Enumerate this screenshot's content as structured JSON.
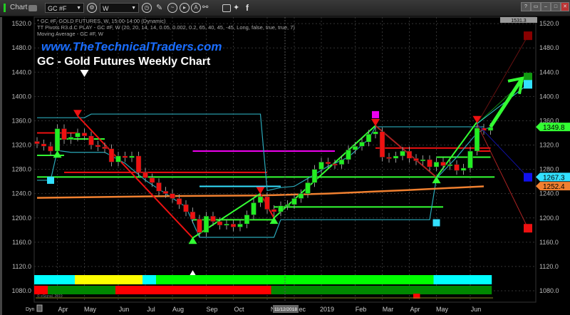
{
  "toolbar": {
    "window_label": "Chart",
    "symbol": "GC #F",
    "interval": "W",
    "icons": [
      "link-icon",
      "clock-icon",
      "pencil-icon",
      "chart-style-icon",
      "play-icon",
      "alert-icon",
      "link-chain-icon",
      "comment-icon",
      "twitter-icon",
      "facebook-icon"
    ],
    "window_buttons": [
      "?",
      "▭",
      "–",
      "□",
      "✕"
    ]
  },
  "legend": [
    "* GC #F, GOLD FUTURES, W, 15:00-14:00 (Dynamic)",
    "TT Pivots R3.d.C PLAY - GC #F, W (20, 20, 14, 14, 0.05, 0.002, 0.2, 65, 40, 45, -45, Long, false, true, true, 7)",
    "Moving Average - GC #F, W"
  ],
  "brand": "www.TheTechnicalTraders.com",
  "title": "GC - Gold Futures Weekly Chart",
  "footer": {
    "dyn_label": "Dyn",
    "cursor_date": "11/12/2018",
    "copyright": "© eSignal, 2019"
  },
  "chart_data": {
    "type": "candlestick",
    "ylim": [
      1060,
      1531.3
    ],
    "yticks": [
      1080,
      1120,
      1160,
      1200,
      1240,
      1280,
      1320,
      1360,
      1400,
      1440,
      1480,
      1520
    ],
    "xtick_labels": [
      [
        "2018-04-02",
        "Apr"
      ],
      [
        "2018-04-30",
        "May"
      ],
      [
        "2018-06-04",
        "Jun"
      ],
      [
        "2018-07-02",
        "Jul"
      ],
      [
        "2018-07-30",
        "Aug"
      ],
      [
        "2018-09-03",
        "Sep"
      ],
      [
        "2018-10-01",
        "Oct"
      ],
      [
        "2018-11-05",
        "N"
      ],
      [
        "2018-12-03",
        "Dec"
      ],
      [
        "2018-12-31",
        "2019"
      ],
      [
        "2019-02-04",
        "Feb"
      ],
      [
        "2019-03-04",
        "Mar"
      ],
      [
        "2019-04-01",
        "Apr"
      ],
      [
        "2019-04-29",
        "May"
      ],
      [
        "2019-06-03",
        "Jun"
      ]
    ],
    "grid": true,
    "dates": [
      "2018-03-12",
      "2018-03-19",
      "2018-03-26",
      "2018-04-02",
      "2018-04-09",
      "2018-04-16",
      "2018-04-23",
      "2018-04-30",
      "2018-05-07",
      "2018-05-14",
      "2018-05-21",
      "2018-05-28",
      "2018-06-04",
      "2018-06-11",
      "2018-06-18",
      "2018-06-25",
      "2018-07-02",
      "2018-07-09",
      "2018-07-16",
      "2018-07-23",
      "2018-07-30",
      "2018-08-06",
      "2018-08-13",
      "2018-08-20",
      "2018-08-27",
      "2018-09-03",
      "2018-09-10",
      "2018-09-17",
      "2018-09-24",
      "2018-10-01",
      "2018-10-08",
      "2018-10-15",
      "2018-10-22",
      "2018-10-29",
      "2018-11-05",
      "2018-11-12",
      "2018-11-19",
      "2018-11-26",
      "2018-12-03",
      "2018-12-10",
      "2018-12-17",
      "2018-12-24",
      "2018-12-31",
      "2019-01-07",
      "2019-01-14",
      "2019-01-21",
      "2019-01-28",
      "2019-02-04",
      "2019-02-11",
      "2019-02-18",
      "2019-02-25",
      "2019-03-04",
      "2019-03-11",
      "2019-03-18",
      "2019-03-25",
      "2019-04-01",
      "2019-04-08",
      "2019-04-15",
      "2019-04-22",
      "2019-04-29",
      "2019-05-06",
      "2019-05-13",
      "2019-05-20",
      "2019-05-27",
      "2019-06-03",
      "2019-06-10",
      "2019-06-17",
      "2019-06-24"
    ],
    "close": [
      1322,
      1318,
      1310,
      1347,
      1329,
      1333,
      1340,
      1335,
      1320,
      1317,
      1314,
      1292,
      1302,
      1299,
      1302,
      1275,
      1266,
      1258,
      1244,
      1240,
      1232,
      1222,
      1210,
      1198,
      1176,
      1203,
      1194,
      1188,
      1190,
      1185,
      1190,
      1205,
      1225,
      1235,
      1214,
      1210,
      1220,
      1222,
      1232,
      1240,
      1258,
      1280,
      1292,
      1289,
      1288,
      1296,
      1312,
      1318,
      1325,
      1338,
      1342,
      1300,
      1298,
      1302,
      1310,
      1298,
      1294,
      1296,
      1284,
      1292,
      1286,
      1288,
      1278,
      1282,
      1310,
      1348,
      1344,
      1349
    ],
    "colors": {
      "up": "#22ee22",
      "down": "#ee1111",
      "background": "#000000"
    },
    "moving_average": {
      "color": "#f08030",
      "points": [
        [
          "2018-03-12",
          1233
        ],
        [
          "2018-04-30",
          1234
        ],
        [
          "2018-07-30",
          1236
        ],
        [
          "2018-10-29",
          1237
        ],
        [
          "2019-01-07",
          1240
        ],
        [
          "2019-04-01",
          1246
        ],
        [
          "2019-06-17",
          1252
        ]
      ]
    },
    "zigzag": [
      {
        "color": "#ee1111",
        "points": [
          [
            "2018-04-23",
            1368
          ],
          [
            "2018-08-20",
            1167
          ]
        ]
      },
      {
        "color": "#33ff33",
        "points": [
          [
            "2018-08-20",
            1167
          ],
          [
            "2018-10-29",
            1240
          ]
        ]
      },
      {
        "color": "#ee1111",
        "points": [
          [
            "2018-10-29",
            1240
          ],
          [
            "2018-11-12",
            1200
          ]
        ]
      },
      {
        "color": "#33ff33",
        "points": [
          [
            "2018-11-12",
            1200
          ],
          [
            "2019-02-25",
            1352
          ]
        ]
      },
      {
        "color": "#aa2222",
        "points": [
          [
            "2019-02-25",
            1352
          ],
          [
            "2019-04-29",
            1267
          ]
        ]
      },
      {
        "color": "#33ff33",
        "points": [
          [
            "2019-04-29",
            1267
          ],
          [
            "2019-06-10",
            1358
          ]
        ]
      }
    ],
    "channels": [
      {
        "color": "#2aa8b8",
        "points": [
          [
            "2018-03-12",
            1365
          ],
          [
            "2018-04-30",
            1365
          ],
          [
            "2018-05-07",
            1371
          ],
          [
            "2018-10-29",
            1371
          ],
          [
            "2018-11-05",
            1245
          ],
          [
            "2018-11-19",
            1250
          ],
          [
            "2018-12-03",
            1252
          ],
          [
            "2018-12-17",
            1265
          ],
          [
            "2019-01-07",
            1285
          ],
          [
            "2019-01-28",
            1300
          ],
          [
            "2019-02-18",
            1330
          ],
          [
            "2019-02-25",
            1350
          ],
          [
            "2019-06-17",
            1350
          ]
        ]
      },
      {
        "color": "#2aa8b8",
        "points": [
          [
            "2018-03-12",
            1262
          ],
          [
            "2018-03-26",
            1262
          ],
          [
            "2018-04-02",
            1311
          ],
          [
            "2018-04-16",
            1308
          ],
          [
            "2018-05-21",
            1308
          ],
          [
            "2018-06-11",
            1290
          ],
          [
            "2018-07-02",
            1262
          ],
          [
            "2018-07-23",
            1240
          ],
          [
            "2018-08-13",
            1218
          ],
          [
            "2018-08-27",
            1168
          ],
          [
            "2018-11-12",
            1168
          ],
          [
            "2018-11-19",
            1197
          ],
          [
            "2019-04-22",
            1197
          ],
          [
            "2019-04-29",
            1265
          ],
          [
            "2019-05-20",
            1300
          ],
          [
            "2019-06-10",
            1340
          ],
          [
            "2019-06-24",
            1350
          ]
        ]
      }
    ],
    "levels": [
      {
        "color": "#33ff33",
        "price": 1267.3,
        "from": "2018-03-12",
        "to": "end"
      },
      {
        "color": "#ee1111",
        "price": 1275,
        "from": "2018-04-09",
        "to": "2018-11-05"
      },
      {
        "color": "#ee00ee",
        "price": 1310,
        "from": "2018-08-20",
        "to": "2019-01-14"
      },
      {
        "color": "#33e0ff",
        "price": 1252,
        "from": "2018-08-27",
        "to": "2018-11-19"
      },
      {
        "color": "#33ff33",
        "price": 1218,
        "from": "2018-11-12",
        "to": "2019-05-06"
      },
      {
        "color": "#33ff33",
        "price": 1197,
        "from": "2018-08-20",
        "to": "2018-11-12"
      },
      {
        "color": "#33ff33",
        "price": 1300,
        "from": "2019-04-29",
        "to": "2019-06-24"
      },
      {
        "color": "#33ff33",
        "price": 1330,
        "from": "2018-04-02",
        "to": "2018-05-21"
      },
      {
        "color": "#33ff33",
        "price": 1303,
        "from": "2018-03-12",
        "to": "2018-04-09"
      },
      {
        "color": "#ee1111",
        "price": 1340,
        "from": "2018-03-12",
        "to": "2018-04-23"
      },
      {
        "color": "#ee1111",
        "price": 1315,
        "from": "2019-02-25",
        "to": "2019-06-24"
      },
      {
        "color": "#ee1111",
        "price": 1310,
        "from": "2019-06-10",
        "to": "2019-06-24"
      }
    ],
    "projections": [
      {
        "color": "#661111",
        "target": 1500,
        "marker": "#880000"
      },
      {
        "color": "#118811",
        "target": 1432,
        "marker": "#119911"
      },
      {
        "color": "#33cccc",
        "target": 1420,
        "marker": "#33e0ff"
      },
      {
        "color": "#1111aa",
        "target": 1267,
        "marker": "#1111ee"
      },
      {
        "color": "#aa2222",
        "target": 1183,
        "marker": "#ee1111"
      }
    ],
    "projection_origin": [
      "2019-06-10",
      1355
    ],
    "arrow": {
      "color": "#33ff33",
      "from": [
        "2019-06-24",
        1350
      ],
      "to_price": 1430
    },
    "markers": [
      {
        "shape": "square",
        "color": "#33e0ff",
        "date": "2018-03-26",
        "price": 1262
      },
      {
        "shape": "square",
        "color": "#33e0ff",
        "date": "2019-04-29",
        "price": 1192
      },
      {
        "shape": "square",
        "color": "#ee00ee",
        "date": "2019-02-25",
        "price": 1370
      },
      {
        "shape": "down",
        "color": "#ffffff",
        "date": "2018-04-30",
        "price": 1438
      },
      {
        "shape": "up",
        "color": "#ffffff",
        "date": "2018-08-20",
        "price": 1108
      },
      {
        "shape": "down",
        "color": "#ee1111",
        "date": "2018-04-23",
        "price": 1372
      },
      {
        "shape": "up",
        "color": "#33ff33",
        "date": "2018-04-02",
        "price": 1305
      },
      {
        "shape": "up",
        "color": "#33ff33",
        "date": "2018-08-20",
        "price": 1163
      },
      {
        "shape": "down",
        "color": "#ee1111",
        "date": "2018-10-29",
        "price": 1245
      },
      {
        "shape": "up",
        "color": "#33ff33",
        "date": "2018-11-12",
        "price": 1196
      },
      {
        "shape": "down",
        "color": "#ee1111",
        "date": "2019-02-25",
        "price": 1357
      },
      {
        "shape": "up",
        "color": "#33ff33",
        "date": "2019-04-29",
        "price": 1263
      },
      {
        "shape": "down",
        "color": "#ee1111",
        "date": "2019-06-10",
        "price": 1362
      }
    ],
    "price_tags": [
      {
        "value": "1531.3",
        "price": 1531.3,
        "color": "#999999"
      },
      {
        "value": "1349.8",
        "price": 1349.8,
        "color": "#33ff33"
      },
      {
        "value": "1267.3",
        "price": 1267.3,
        "color": "#33e0ff"
      },
      {
        "value": "1252.4",
        "price": 1252.4,
        "color": "#f08030"
      }
    ],
    "bands": [
      {
        "segments": [
          [
            "2018-03-12",
            "2018-04-23",
            "#00ffff"
          ],
          [
            "2018-04-23",
            "2018-07-02",
            "#ffff00"
          ],
          [
            "2018-07-02",
            "2018-07-16",
            "#00ffff"
          ],
          [
            "2018-07-16",
            "2019-04-29",
            "#00ff00"
          ],
          [
            "2019-04-29",
            "end",
            "#00ffff"
          ]
        ]
      },
      {
        "segments": [
          [
            "2018-03-12",
            "2018-03-26",
            "#ff0000"
          ],
          [
            "2018-03-26",
            "2018-06-04",
            "#008800"
          ],
          [
            "2018-06-04",
            "2018-11-12",
            "#ff0000"
          ],
          [
            "2018-11-12",
            "end",
            "#008800"
          ]
        ]
      },
      {
        "segments": [
          [
            "2019-04-08",
            "2019-04-15",
            "#ff0000"
          ]
        ]
      }
    ]
  }
}
